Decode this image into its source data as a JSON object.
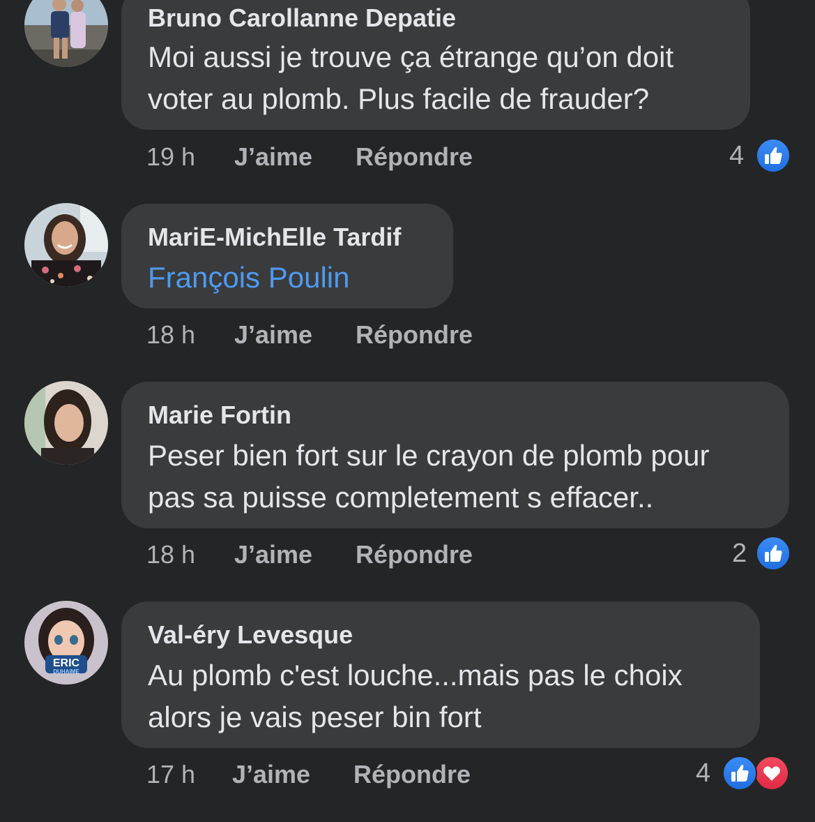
{
  "comments": [
    {
      "author": "Bruno Carollanne Depatie",
      "lines": [
        "Moi aussi je trouve ça étrange qu’on doit",
        "voter au plomb. Plus facile de frauder?"
      ],
      "time": "19 h",
      "like_label": "J’aime",
      "reply_label": "Répondre",
      "reaction_count": "4",
      "reactions": [
        "like-icon"
      ]
    },
    {
      "author": "MariE-MichElle Tardif",
      "mention": "François Poulin",
      "time": "18 h",
      "like_label": "J’aime",
      "reply_label": "Répondre"
    },
    {
      "author": "Marie Fortin",
      "lines": [
        "Peser bien fort sur le crayon de plomb pour",
        "pas sa puisse completement s effacer.."
      ],
      "time": "18 h",
      "like_label": "J’aime",
      "reply_label": "Répondre",
      "reaction_count": "2",
      "reactions": [
        "like-icon"
      ]
    },
    {
      "author": "Val-éry Levesque",
      "lines": [
        "Au plomb c'est louche...mais pas le choix",
        "alors je vais peser bin fort"
      ],
      "time": "17 h",
      "like_label": "J’aime",
      "reply_label": "Répondre",
      "reaction_count": "4",
      "reactions": [
        "like-icon",
        "love-icon"
      ],
      "avatar_text": [
        "ERIC",
        "DUHAIME"
      ]
    }
  ],
  "colors": {
    "background": "#242526",
    "bubble": "#3a3b3c",
    "text": "#e4e6eb",
    "secondary_text": "#b0b3b8",
    "mention": "#4e9af1",
    "like": "#1f6fe0",
    "love": "#e02b44"
  }
}
